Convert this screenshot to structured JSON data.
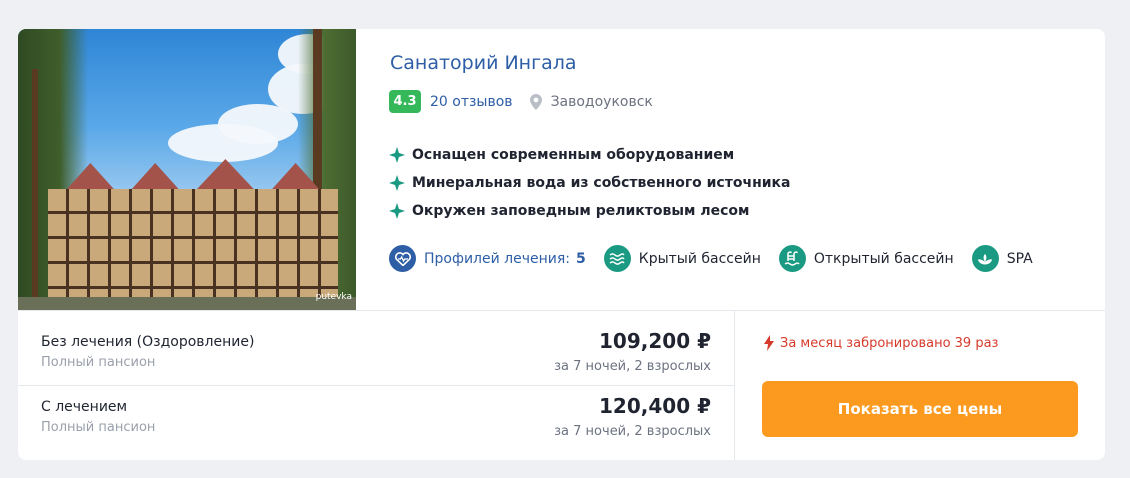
{
  "hotel": {
    "title": "Санаторий Ингала",
    "rating": "4.3",
    "reviews": "20 отзывов",
    "city": "Заводоуковск",
    "photo_watermark": "putevka"
  },
  "features": [
    "Оснащен современным оборудованием",
    "Минеральная вода из собственного источника",
    "Окружен заповедным реликтовым лесом"
  ],
  "amenities": {
    "profiles_label": "Профилей лечения:",
    "profiles_count": "5",
    "indoor_pool": "Крытый бассейн",
    "outdoor_pool": "Открытый бассейн",
    "spa": "SPA"
  },
  "offers": [
    {
      "name": "Без лечения (Оздоровление)",
      "board": "Полный пансион",
      "price": "109,200 ₽",
      "terms": "за 7 ночей, 2 взрослых"
    },
    {
      "name": "С лечением",
      "board": "Полный пансион",
      "price": "120,400 ₽",
      "terms": "за 7 ночей, 2 взрослых"
    }
  ],
  "booking": {
    "notice": "За месяц забронировано 39 раз",
    "button_label": "Показать все цены"
  },
  "colors": {
    "title_blue": "#2d5ea6",
    "rating_green": "#35b85a",
    "accent_teal": "#1a9a82",
    "cta_orange": "#fb9a1f",
    "alert_red": "#d63a2a"
  },
  "icons": [
    "star-icon",
    "location-pin-icon",
    "heart-pulse-icon",
    "pool-waves-icon",
    "pool-ladder-icon",
    "lotus-icon",
    "lightning-icon"
  ]
}
